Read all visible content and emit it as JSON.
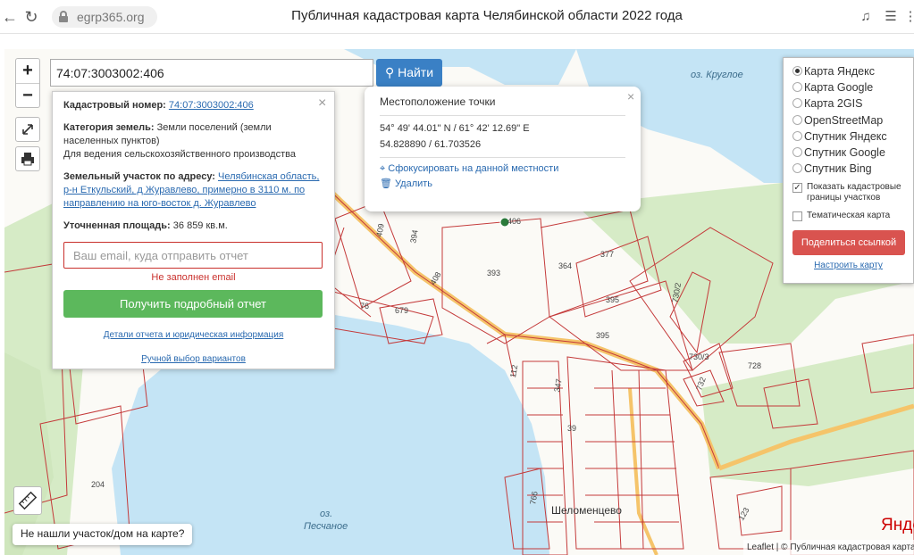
{
  "browser": {
    "url": "egrp365.org",
    "title": "Публичная кадастровая карта Челябинской области 2022 года"
  },
  "search": {
    "value": "74:07:3003002:406",
    "button_label": "Найти"
  },
  "zoom": {
    "in_label": "+",
    "out_label": "−"
  },
  "info_panel": {
    "cadastral_label": "Кадастровый номер:",
    "cadastral_value": "74:07:3003002:406",
    "category_label": "Категория земель:",
    "category_value": "Земли поселений (земли населенных пунктов)",
    "usage_value": "Для ведения сельскохозяйственного производства",
    "address_label": "Земельный участок по адресу:",
    "address_value": "Челябинская область, р-н Еткульский, д Журавлево, примерно в 3110 м. по направлению на юго-восток д. Журавлево",
    "area_label": "Уточненная площадь:",
    "area_value": "36 859 кв.м.",
    "email_placeholder": "Ваш email, куда отправить отчет",
    "email_error": "Не заполнен email",
    "report_button": "Получить подробный отчет",
    "details_link": "Детали отчета и юридическая информация",
    "manual_link": "Ручной выбор вариантов"
  },
  "location_popup": {
    "title": "Местоположение точки",
    "dms": "54° 49' 44.01\" N / 61° 42' 12.69\" E",
    "decimal": "54.828890 / 61.703526",
    "focus_action": "Сфокусировать на данной местности",
    "delete_action": "Удалить"
  },
  "layers": {
    "options": [
      {
        "label": "Карта Яндекс",
        "selected": true
      },
      {
        "label": "Карта Google",
        "selected": false
      },
      {
        "label": "Карта 2GIS",
        "selected": false
      },
      {
        "label": "OpenStreetMap",
        "selected": false
      },
      {
        "label": "Спутник Яндекс",
        "selected": false
      },
      {
        "label": "Спутник Google",
        "selected": false
      },
      {
        "label": "Спутник Bing",
        "selected": false
      }
    ],
    "cadastral_borders_label": "Показать кадастровые границы участков",
    "cadastral_borders_checked": true,
    "thematic_label": "Тематическая карта",
    "thematic_checked": false,
    "share_button": "Поделиться ссылкой",
    "setup_link": "Настроить карту"
  },
  "map": {
    "lake_krugloe": "оз. Круглое",
    "lake_peschanoe_1": "оз.",
    "lake_peschanoe_2": "Песчаное",
    "village": "Шеломенцево",
    "plot_labels": [
      "406",
      "394",
      "393",
      "364",
      "377",
      "395",
      "395",
      "730/2",
      "730/3",
      "728",
      "732",
      "76",
      "679",
      "204",
      "766",
      "123",
      "39",
      "112",
      "347",
      "408",
      "409"
    ],
    "not_found_button": "Не нашли участок/дом на карте?",
    "attribution": "Leaflet | © Публичная кадастровая карта",
    "yandex_logo": "Яндекс"
  },
  "colors": {
    "water": "#c4e4f5",
    "forest": "#d6ebc6",
    "parcel_border": "#c43a3a",
    "road": "#f5c46a",
    "primary_button": "#3a80c5",
    "success_button": "#5cb85c",
    "danger_button": "#d9534f"
  }
}
